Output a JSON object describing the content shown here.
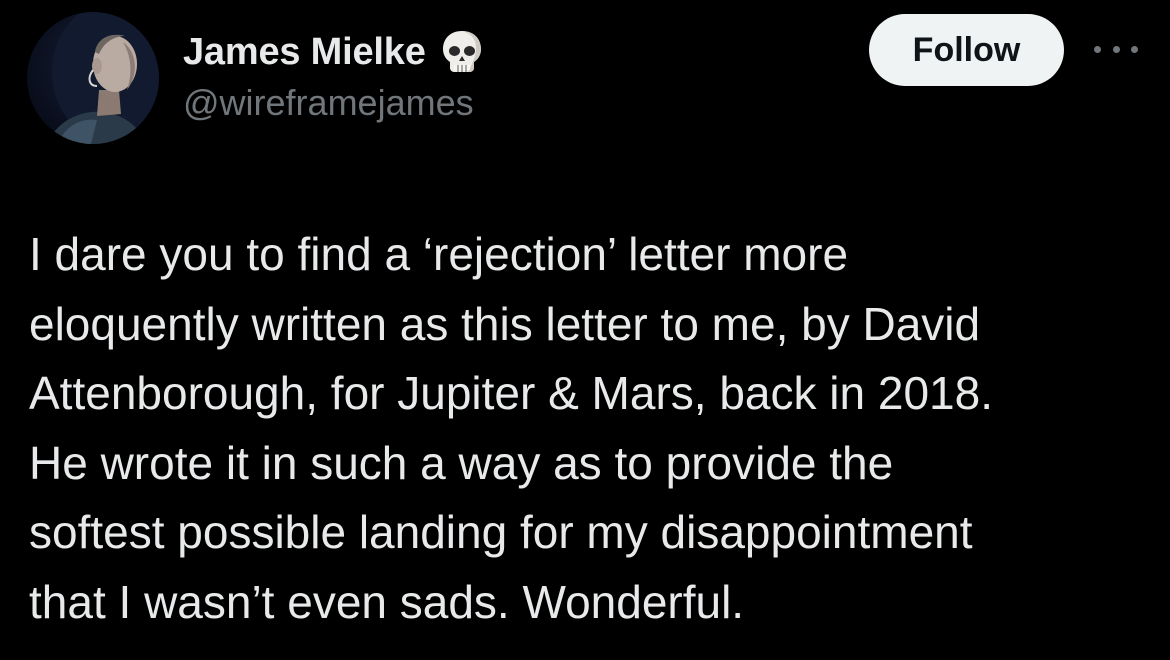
{
  "author": {
    "display_name": "James Mielke",
    "badge_emoji": "skull-icon",
    "handle": "@wireframejames"
  },
  "actions": {
    "follow_label": "Follow",
    "more_icon": "more-horizontal-icon"
  },
  "tweet": {
    "lines": [
      "I dare you to find a ‘rejection’ letter more",
      "eloquently written as this letter to me, by David",
      "Attenborough, for Jupiter & Mars, back in 2018.",
      "He wrote it in such a way as to provide the",
      "softest possible landing for my disappointment",
      "that I wasn’t even sads. Wonderful."
    ]
  },
  "colors": {
    "background": "#000000",
    "primary_text": "#e7e9ea",
    "secondary_text": "#71767b",
    "follow_button_bg": "#eff3f4",
    "follow_button_text": "#0f1419"
  }
}
